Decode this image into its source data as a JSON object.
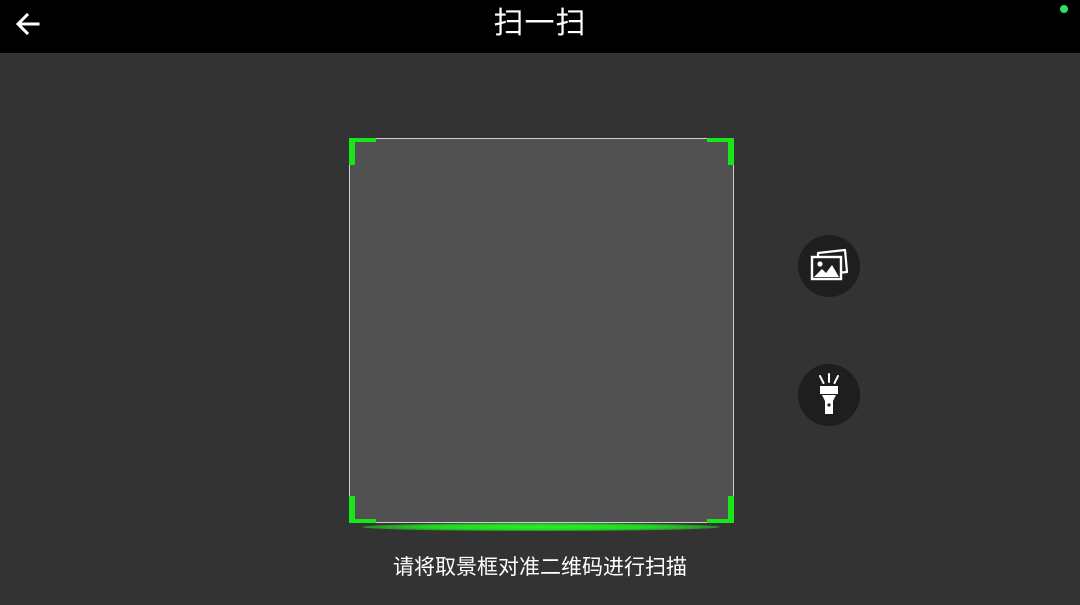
{
  "header": {
    "title": "扫一扫",
    "back_icon": "arrow-left-icon",
    "status_dot_color": "#2ee06a"
  },
  "scanner": {
    "hint": "请将取景框对准二维码进行扫描",
    "frame_accent_color": "#19e619",
    "scan_line_color": "#22d822"
  },
  "actions": {
    "gallery_icon": "photo-gallery-icon",
    "flashlight_icon": "flashlight-icon"
  },
  "colors": {
    "background": "#333333",
    "topbar": "#000000",
    "frame_fill": "#515151",
    "button_bg": "#1e1e1e"
  }
}
